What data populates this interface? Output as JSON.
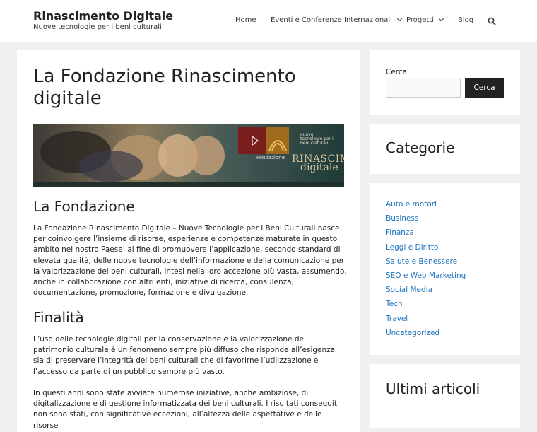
{
  "header": {
    "site_title": "Rinascimento Digitale",
    "tagline": "Nuove tecnologie per i beni culturali",
    "nav": [
      {
        "label": "Home"
      },
      {
        "label": "Eventi e Conferenze Internazionali"
      },
      {
        "label": "Progetti"
      },
      {
        "label": "Blog"
      }
    ],
    "search_icon": "search-icon"
  },
  "main": {
    "title": "La Fondazione Rinascimento digitale",
    "banner": {
      "small_text": "Fondazione",
      "brand_top": "RINASCIMENTO",
      "brand_bottom": "digitale",
      "nuove": "nuove tecnologie per i beni culturali"
    },
    "sections": [
      {
        "heading": "La Fondazione",
        "paragraphs": [
          "La Fondazione Rinascimento Digitale – Nuove Tecnologie per i Beni Culturali nasce per coinvolgere l’insieme di risorse, esperienze e competenze maturate in questo ambito nel nostro Paese, al fine di promuovere l’applicazione, secondo standard di elevata qualità, delle nuove tecnologie dell’informazione e della comunicazione per la valorizzazione dei beni culturali, intesi nella loro accezione più vasta, assumendo, anche in collaborazione con altri enti, iniziative di ricerca, consulenza, documentazione, promozione, formazione e divulgazione."
        ]
      },
      {
        "heading": "Finalità",
        "paragraphs": [
          "L’uso delle tecnologie digitali per la conservazione e la valorizzazione del patrimonio culturale è un fenomeno sempre più diffuso che risponde all’esigenza sia di preservare l’integrità dei beni culturali che di favorirne l’utilizzazione e l’accesso da parte di un pubblico sempre più vasto.",
          "In questi anni sono state avviate numerose iniziative, anche ambiziose, di digitalizzazione e di gestione informatizzata dei beni culturali. I risultati conseguiti non sono stati, con significative eccezioni, all’altezza delle aspettative e delle risorse"
        ]
      }
    ]
  },
  "sidebar": {
    "search": {
      "label": "Cerca",
      "button": "Cerca",
      "placeholder": ""
    },
    "categories_title": "Categorie",
    "categories": [
      "Auto e motori",
      "Business",
      "Finanza",
      "Leggi e Diritto",
      "Salute e Benessere",
      "SEO e Web Marketing",
      "Social Media",
      "Tech",
      "Travel",
      "Uncategorized"
    ],
    "recent_title": "Ultimi articoli"
  }
}
